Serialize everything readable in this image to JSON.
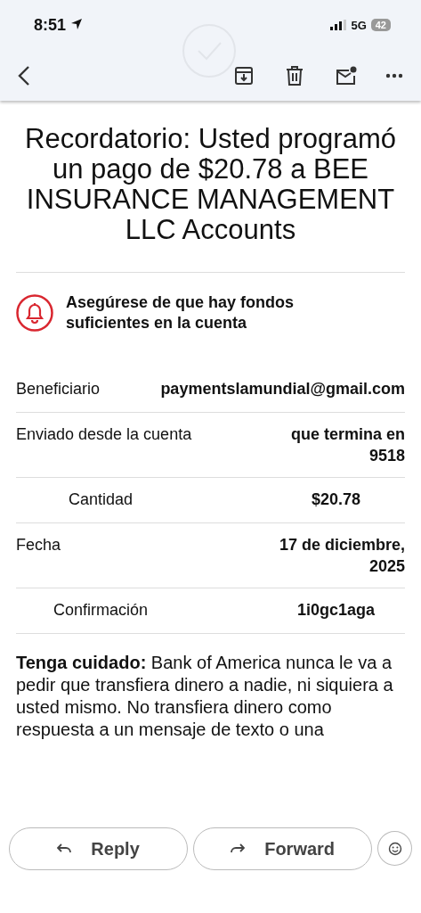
{
  "status_bar": {
    "time": "8:51",
    "network": "5G",
    "battery": "42"
  },
  "title": "Recordatorio: Usted programó un pago de $20.78 a BEE INSURANCE MANAGEMENT LLC Accounts",
  "notice": "Asegúrese de que hay fondos suficientes en la cuenta",
  "details": [
    {
      "kind": "plain",
      "label": "Beneficiario",
      "value": "paymentslamundial@gmail.com"
    },
    {
      "kind": "plain",
      "label": "Enviado desde la cuenta",
      "value": "que termina en 9518"
    },
    {
      "kind": "centered",
      "label": "Cantidad",
      "value": "$20.78"
    },
    {
      "kind": "plain",
      "label": "Fecha",
      "value": "17 de diciembre, 2025"
    },
    {
      "kind": "centered",
      "label": "Confirmación",
      "value": "1i0gc1aga"
    }
  ],
  "warning": "**Tenga cuidado:** Bank of America nunca le va a pedir que transfiera dinero a nadie, ni siquiera a usted mismo. No transfiera dinero como respuesta a un mensaje de texto o una",
  "actions": [
    "Reply",
    "Forward"
  ]
}
